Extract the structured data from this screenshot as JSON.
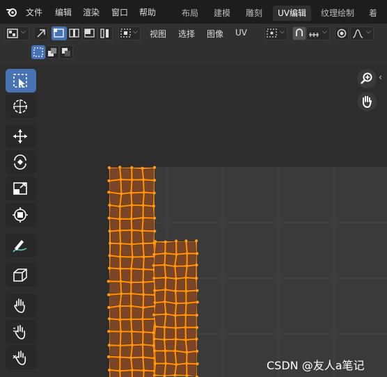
{
  "menu": {
    "file": "文件",
    "edit": "编辑",
    "render": "渲染",
    "window": "窗口",
    "help": "帮助"
  },
  "workspaces": [
    {
      "label": "布局",
      "active": false
    },
    {
      "label": "建模",
      "active": false
    },
    {
      "label": "雕刻",
      "active": false
    },
    {
      "label": "UV编辑",
      "active": true
    },
    {
      "label": "纹理绘制",
      "active": false
    },
    {
      "label": "着色",
      "active": false
    }
  ],
  "header": {
    "view": "视图",
    "select": "选择",
    "image": "图像",
    "uv": "UV"
  },
  "icons": {
    "logo": "blender-logo-icon",
    "editor_type": "image-editor-icon",
    "sync": "uv-sync-selection-icon",
    "select_modes": [
      "vertex-select-icon",
      "edge-select-icon",
      "face-select-icon",
      "island-select-icon"
    ],
    "sticky": "sticky-selection-icon",
    "pivot": "pivot-point-icon",
    "snap": "snap-icon",
    "snap_target": "snap-increment-icon",
    "proportional": "proportional-edit-icon",
    "falloff": "falloff-curve-icon",
    "mode_buttons": [
      "select-new-icon",
      "select-extend-icon",
      "select-subtract-icon"
    ]
  },
  "toolbar": [
    {
      "name": "select-box-tool",
      "icon": "select-box-icon",
      "active": true
    },
    {
      "name": "cursor-tool",
      "icon": "cursor-icon",
      "active": false
    },
    {
      "name": "move-tool",
      "icon": "move-icon",
      "active": false
    },
    {
      "name": "rotate-tool",
      "icon": "rotate-icon",
      "active": false
    },
    {
      "name": "scale-tool",
      "icon": "scale-icon",
      "active": false
    },
    {
      "name": "transform-tool",
      "icon": "transform-icon",
      "active": false
    },
    {
      "name": "annotate-tool",
      "icon": "annotate-icon",
      "active": false
    },
    {
      "name": "project-tool",
      "icon": "cube-project-icon",
      "active": false
    },
    {
      "name": "grab-tool",
      "icon": "grab-icon",
      "active": false
    },
    {
      "name": "relax-tool",
      "icon": "relax-icon",
      "active": false
    },
    {
      "name": "pinch-tool",
      "icon": "pinch-icon",
      "active": false
    }
  ],
  "nav": {
    "zoom": "zoom-icon",
    "pan": "hand-pan-icon",
    "collapse": "chevron-left-icon"
  },
  "colors": {
    "accent": "#4772b3",
    "uv_face": "#7a4628",
    "uv_edge": "#ff8c00",
    "uv_vertex": "#ff9a1a"
  },
  "watermark": "CSDN @友人a笔记"
}
